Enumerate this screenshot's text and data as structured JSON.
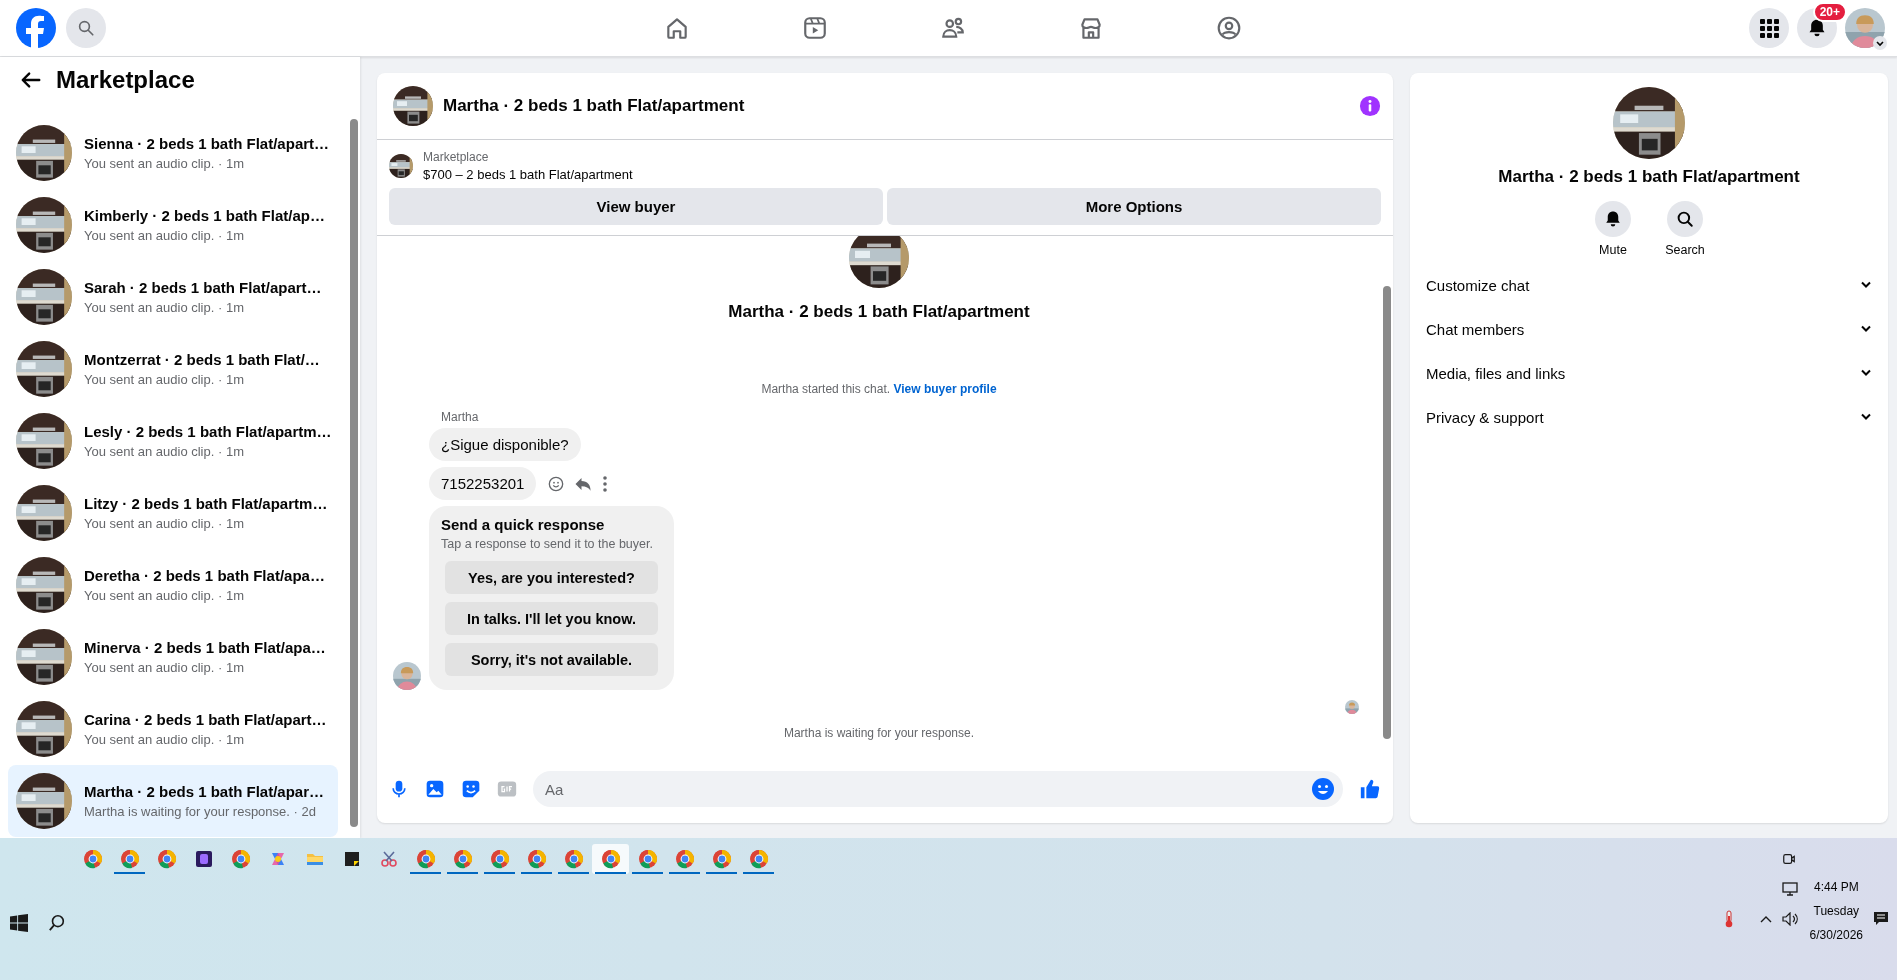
{
  "topbar": {
    "notifications_badge": "20+"
  },
  "sidebar": {
    "title": "Marketplace",
    "conversations": [
      {
        "title": "Sienna · 2 beds 1 bath Flat/apart…",
        "preview": "You sent an audio clip. · 1m",
        "selected": false
      },
      {
        "title": "Kimberly · 2 beds 1 bath Flat/ap…",
        "preview": "You sent an audio clip. · 1m",
        "selected": false
      },
      {
        "title": "Sarah · 2 beds 1 bath Flat/apart…",
        "preview": "You sent an audio clip. · 1m",
        "selected": false
      },
      {
        "title": "Montzerrat · 2 beds 1 bath Flat/…",
        "preview": "You sent an audio clip. · 1m",
        "selected": false
      },
      {
        "title": "Lesly · 2 beds 1 bath Flat/apartm…",
        "preview": "You sent an audio clip. · 1m",
        "selected": false
      },
      {
        "title": "Litzy · 2 beds 1 bath Flat/apartm…",
        "preview": "You sent an audio clip. · 1m",
        "selected": false
      },
      {
        "title": "Deretha · 2 beds 1 bath Flat/apa…",
        "preview": "You sent an audio clip. · 1m",
        "selected": false
      },
      {
        "title": "Minerva · 2 beds 1 bath Flat/apa…",
        "preview": "You sent an audio clip. · 1m",
        "selected": false
      },
      {
        "title": "Carina · 2 beds 1 bath Flat/apart…",
        "preview": "You sent an audio clip. · 1m",
        "selected": false
      },
      {
        "title": "Martha · 2 beds 1 bath Flat/apar…",
        "preview": "Martha is waiting for your response. · 2d",
        "selected": true
      }
    ]
  },
  "chat": {
    "title": "Martha · 2 beds 1 bath Flat/apartment",
    "listing_label": "Marketplace",
    "listing": "$700 – 2 beds 1 bath Flat/apartment",
    "buttons": [
      "View buyer",
      "More Options"
    ],
    "intro_title": "Martha · 2 beds 1 bath Flat/apartment",
    "started_text": "Martha started this chat.",
    "profile_link": "View buyer profile",
    "sender": "Martha",
    "messages": [
      "¿Sigue disponible?",
      "7152253201"
    ],
    "quick_response": {
      "title": "Send a quick response",
      "hint": "Tap a response to send it to the buyer.",
      "options": [
        "Yes, are you interested?",
        "In talks. I'll let you know.",
        "Sorry, it's not available."
      ]
    },
    "status": "Martha is waiting for your response.",
    "composer": {
      "placeholder": "Aa"
    }
  },
  "info": {
    "title": "Martha · 2 beds 1 bath Flat/apartment",
    "actions": [
      {
        "kind": "mute",
        "label": "Mute"
      },
      {
        "kind": "search",
        "label": "Search"
      }
    ],
    "sections": [
      {
        "label": "Customize chat",
        "expanded": false
      },
      {
        "label": "Chat members",
        "expanded": false
      },
      {
        "label": "Media, files and links",
        "expanded": false
      },
      {
        "label": "Privacy & support",
        "expanded": false
      }
    ]
  },
  "taskbar": {
    "apps": [
      {
        "kind": "chrome",
        "open": false,
        "active": false
      },
      {
        "kind": "chrome",
        "open": true,
        "active": false
      },
      {
        "kind": "chrome",
        "open": false,
        "active": false
      },
      {
        "kind": "purple",
        "open": false,
        "active": false
      },
      {
        "kind": "chrome",
        "open": false,
        "active": false
      },
      {
        "kind": "copilot",
        "open": false,
        "active": false
      },
      {
        "kind": "folder",
        "open": false,
        "active": false
      },
      {
        "kind": "note",
        "open": false,
        "active": false
      },
      {
        "kind": "snip",
        "open": false,
        "active": false
      },
      {
        "kind": "chrome",
        "open": true,
        "active": false
      },
      {
        "kind": "chrome",
        "open": true,
        "active": false
      },
      {
        "kind": "chrome",
        "open": true,
        "active": false
      },
      {
        "kind": "chrome",
        "open": true,
        "active": false
      },
      {
        "kind": "chrome",
        "open": true,
        "active": false
      },
      {
        "kind": "chrome",
        "open": true,
        "active": true
      },
      {
        "kind": "chrome",
        "open": true,
        "active": false
      },
      {
        "kind": "chrome",
        "open": true,
        "active": false
      },
      {
        "kind": "chrome",
        "open": true,
        "active": false
      },
      {
        "kind": "chrome",
        "open": true,
        "active": false
      }
    ],
    "time": "4:44 PM",
    "day": "Tuesday",
    "date": "6/30/2026"
  }
}
